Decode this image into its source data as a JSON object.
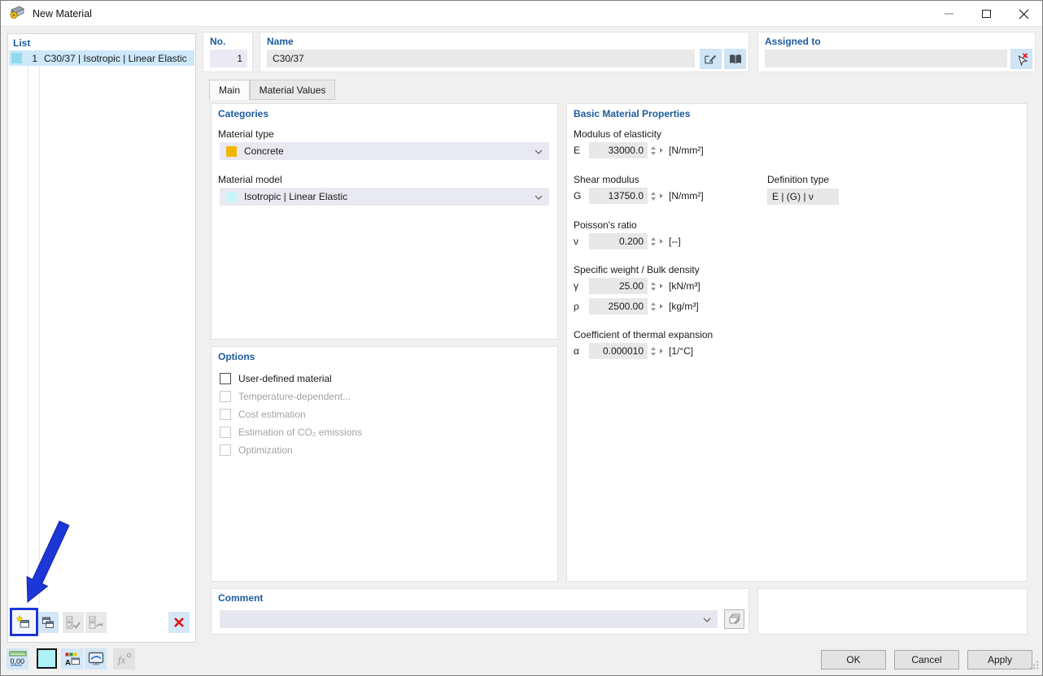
{
  "window": {
    "title": "New Material"
  },
  "list_panel": {
    "header": "List",
    "rows": [
      {
        "no": "1",
        "name": "C30/37 | Isotropic | Linear Elastic",
        "swatch": "#8edcee"
      }
    ]
  },
  "header_fields": {
    "no": {
      "label": "No.",
      "value": "1"
    },
    "name": {
      "label": "Name",
      "value": "C30/37"
    },
    "assigned": {
      "label": "Assigned to",
      "value": ""
    }
  },
  "tabs": {
    "main": "Main",
    "material_values": "Material Values"
  },
  "main_tab": {
    "categories": {
      "title": "Categories",
      "material_type": {
        "label": "Material type",
        "value": "Concrete",
        "swatch": "#f2b600"
      },
      "material_model": {
        "label": "Material model",
        "value": "Isotropic | Linear Elastic",
        "swatch": "#c9f4fa"
      }
    },
    "options": {
      "title": "Options",
      "items": [
        {
          "label": "User-defined material",
          "checked": false,
          "enabled": true
        },
        {
          "label": "Temperature-dependent...",
          "checked": false,
          "enabled": false
        },
        {
          "label": "Cost estimation",
          "checked": false,
          "enabled": false
        },
        {
          "label": "Estimation of CO₂ emissions",
          "checked": false,
          "enabled": false
        },
        {
          "label": "Optimization",
          "checked": false,
          "enabled": false
        }
      ]
    },
    "properties": {
      "title": "Basic Material Properties",
      "modulus": {
        "label": "Modulus of elasticity",
        "symbol": "E",
        "value": "33000.0",
        "unit": "[N/mm²]"
      },
      "shear": {
        "label": "Shear modulus",
        "symbol": "G",
        "value": "13750.0",
        "unit": "[N/mm²]"
      },
      "definition_type": {
        "label": "Definition type",
        "value": "E | (G) | ν"
      },
      "poisson": {
        "label": "Poisson's ratio",
        "symbol": "ν",
        "value": "0.200",
        "unit": "[--]"
      },
      "weight": {
        "label": "Specific weight / Bulk density",
        "gamma": {
          "symbol": "γ",
          "value": "25.00",
          "unit": "[kN/m³]"
        },
        "rho": {
          "symbol": "ρ",
          "value": "2500.00",
          "unit": "[kg/m³]"
        }
      },
      "thermal": {
        "label": "Coefficient of thermal expansion",
        "symbol": "α",
        "value": "0.000010",
        "unit": "[1/°C]"
      }
    },
    "comment": {
      "title": "Comment",
      "value": ""
    }
  },
  "footer": {
    "ok": "OK",
    "cancel": "Cancel",
    "apply": "Apply"
  },
  "colors": {
    "accent_blue": "#1b5c9d",
    "selection_blue": "#cde8f9",
    "toolbutton_blue": "#d3e7f7",
    "annotation_blue": "#1d36d8",
    "delete_red": "#e01212",
    "concrete_swatch": "#f2b600",
    "model_swatch": "#c9f4fa",
    "list_swatch": "#8edcee"
  }
}
